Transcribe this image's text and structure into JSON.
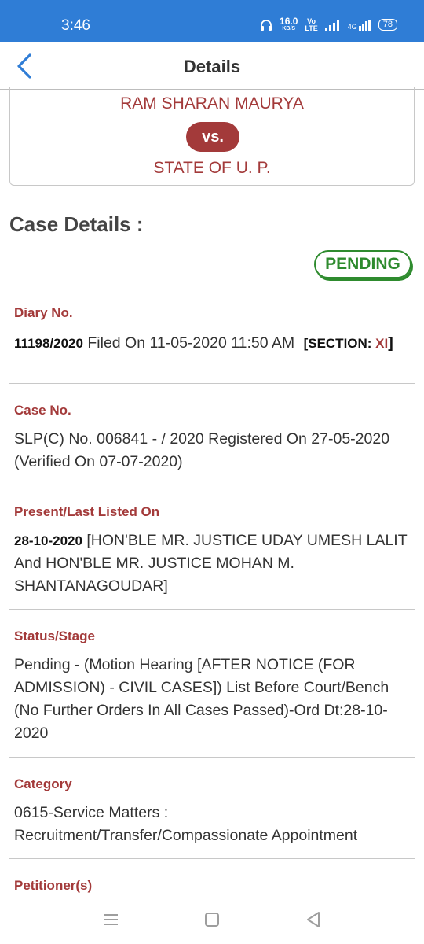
{
  "status_bar": {
    "time": "3:46",
    "speed_value": "16.0",
    "speed_unit": "KB/S",
    "volte_top": "Vo",
    "volte_bottom": "LTE",
    "network": "4G",
    "battery": "78"
  },
  "header": {
    "title": "Details"
  },
  "parties": {
    "petitioner": "RAM SHARAN MAURYA",
    "vs": "vs.",
    "respondent": "STATE OF U. P."
  },
  "case_details": {
    "title": "Case Details :",
    "status_badge": "PENDING",
    "diary": {
      "label": "Diary No.",
      "number": "11198/2020",
      "filed_text": " Filed On 11-05-2020 11:50 AM ",
      "section_prefix": "[SECTION: ",
      "section_value": "XI",
      "section_suffix": "]"
    },
    "case_no": {
      "label": "Case No.",
      "value": "SLP(C) No. 006841 - / 2020  Registered On 27-05-2020 (Verified On 07-07-2020)"
    },
    "listed": {
      "label": "Present/Last Listed On",
      "date": "28-10-2020",
      "bench": " [HON'BLE MR. JUSTICE UDAY UMESH LALIT And HON'BLE MR. JUSTICE MOHAN M. SHANTANAGOUDAR]"
    },
    "status_stage": {
      "label": "Status/Stage",
      "value": "Pending - (Motion Hearing  [AFTER NOTICE (FOR ADMISSION) - CIVIL CASES]) List Before Court/Bench (No Further Orders In All Cases Passed)-Ord Dt:28-10-2020"
    },
    "category": {
      "label": "Category",
      "value": "0615-Service Matters : Recruitment/Transfer/Compassionate Appointment"
    },
    "petitioners": {
      "label": "Petitioner(s)"
    }
  },
  "icons": {
    "back": "chevron-left-icon",
    "nav_menu": "menu-icon",
    "nav_home": "square-icon",
    "nav_back": "triangle-back-icon"
  },
  "colors": {
    "status_bar": "#2f7dd6",
    "accent_red": "#a33a3a",
    "pending_green": "#2e8b2e"
  }
}
